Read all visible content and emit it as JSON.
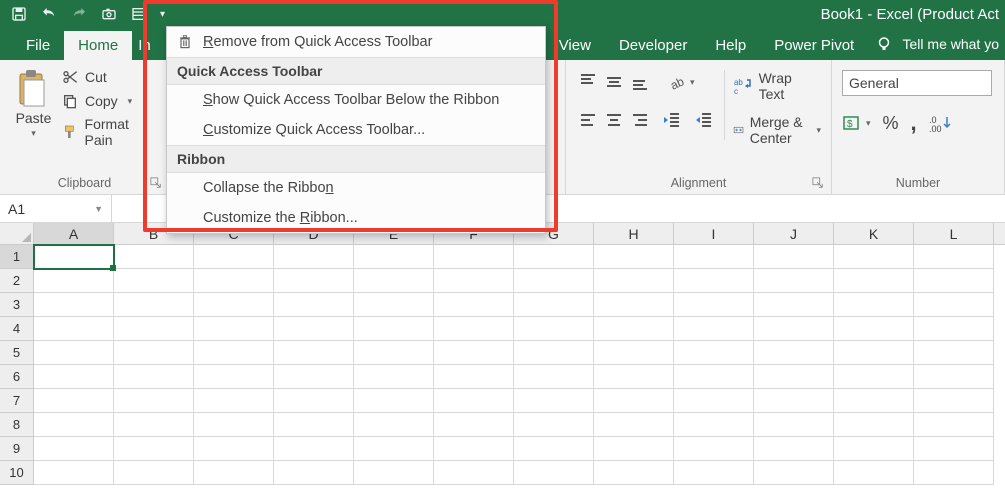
{
  "title": "Book1  -  Excel (Product Act",
  "tabs": {
    "file": "File",
    "home": "Home",
    "insert_trim": "In",
    "view_trim": "View",
    "developer": "Developer",
    "help": "Help",
    "powerpivot": "Power Pivot"
  },
  "tell_me": "Tell me what yo",
  "clipboard": {
    "paste": "Paste",
    "cut": "Cut",
    "copy": "Copy",
    "format_painter": "Format Pain",
    "group": "Clipboard"
  },
  "alignment": {
    "wrap": "Wrap Text",
    "merge": "Merge & Center",
    "group": "Alignment"
  },
  "number": {
    "format": "General",
    "percent": "%",
    "comma": ",",
    "group": "Number"
  },
  "namebox": "A1",
  "columns": [
    "A",
    "B",
    "C",
    "D",
    "E",
    "F",
    "G",
    "H",
    "I",
    "J",
    "K",
    "L"
  ],
  "rows": [
    "1",
    "2",
    "3",
    "4",
    "5",
    "6",
    "7",
    "8",
    "9",
    "10"
  ],
  "ctx": {
    "remove": "Remove from Quick Access Toolbar",
    "h1": "Quick Access Toolbar",
    "show_below": "Show Quick Access Toolbar Below the Ribbon",
    "customize_qat": "Customize Quick Access Toolbar...",
    "h2": "Ribbon",
    "collapse": "Collapse the Ribbon",
    "customize_ribbon": "Customize the Ribbon..."
  }
}
